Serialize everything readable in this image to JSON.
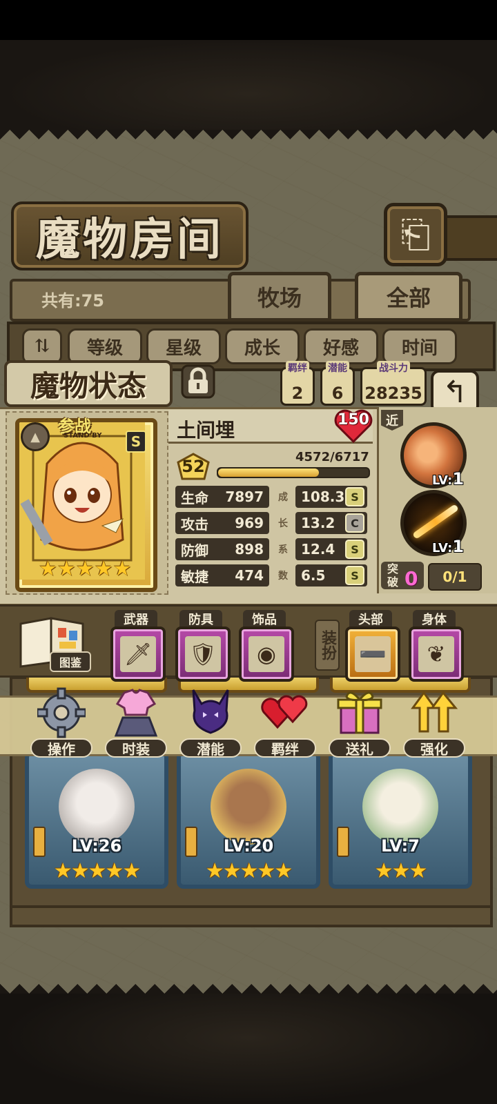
{
  "header": {
    "room_title": "魔物房间",
    "back_icon": "back-arrow-icon"
  },
  "inventory": {
    "count_label": "共有:75",
    "tabs": [
      {
        "label": "牧场",
        "selected": false
      },
      {
        "label": "全部",
        "selected": true
      }
    ]
  },
  "sort": {
    "toggle_icon": "sort-order-icon",
    "buttons": [
      "等级",
      "星级",
      "成长",
      "好感",
      "时间"
    ]
  },
  "status": {
    "title": "魔物状态",
    "bond_label": "羁绊",
    "bond_value": "2",
    "potential_label": "潜能",
    "potential_value": "6",
    "power_label": "战斗力",
    "power_value": "28235",
    "locked": true
  },
  "monster": {
    "standby_label": "参战",
    "standby_en": "STAND BY",
    "rank": "S",
    "name": "土间埋",
    "love": "150",
    "level": "52",
    "exp_text": "4572/6717",
    "exp_fraction": 0.681,
    "stars": 5,
    "stats": [
      {
        "key": "生命",
        "value": "7897",
        "growth": "108.3",
        "grade": "S"
      },
      {
        "key": "攻击",
        "value": "969",
        "growth": "13.2",
        "grade": "C"
      },
      {
        "key": "防御",
        "value": "898",
        "growth": "12.4",
        "grade": "S"
      },
      {
        "key": "敏捷",
        "value": "474",
        "growth": "6.5",
        "grade": "S"
      }
    ],
    "growth_vertical_label": [
      "成",
      "长",
      "系",
      "数"
    ],
    "range_label": "近",
    "skills": [
      {
        "lv_prefix": "LV:",
        "lv": "1"
      },
      {
        "lv_prefix": "LV:",
        "lv": "1"
      }
    ],
    "break_label": "突破",
    "break_count": "0",
    "break_progress": "0/1"
  },
  "equipment": {
    "book_label": "图鉴",
    "dress_label": "装扮",
    "slots": [
      {
        "label": "武器"
      },
      {
        "label": "防具"
      },
      {
        "label": "饰品"
      },
      {
        "label": "头部"
      },
      {
        "label": "身体"
      }
    ]
  },
  "actions": [
    {
      "label": "操作",
      "icon": "gear-icon"
    },
    {
      "label": "时装",
      "icon": "outfit-icon"
    },
    {
      "label": "潜能",
      "icon": "demon-icon"
    },
    {
      "label": "羁绊",
      "icon": "hearts-icon"
    },
    {
      "label": "送礼",
      "icon": "gift-icon"
    },
    {
      "label": "强化",
      "icon": "upgrade-arrows-icon"
    }
  ],
  "monster_list": [
    {
      "lv": "LV:26",
      "stars": "★★★★★"
    },
    {
      "lv": "LV:20",
      "stars": "★★★★★"
    },
    {
      "lv": "LV:7",
      "stars": "★★★"
    }
  ],
  "colors": {
    "panel": "#cfc5a3",
    "accent_gold": "#ffc826",
    "slot_purple": "#b64aa8",
    "slot_gold": "#f2b23a",
    "break_pink": "#ff6ad3"
  }
}
